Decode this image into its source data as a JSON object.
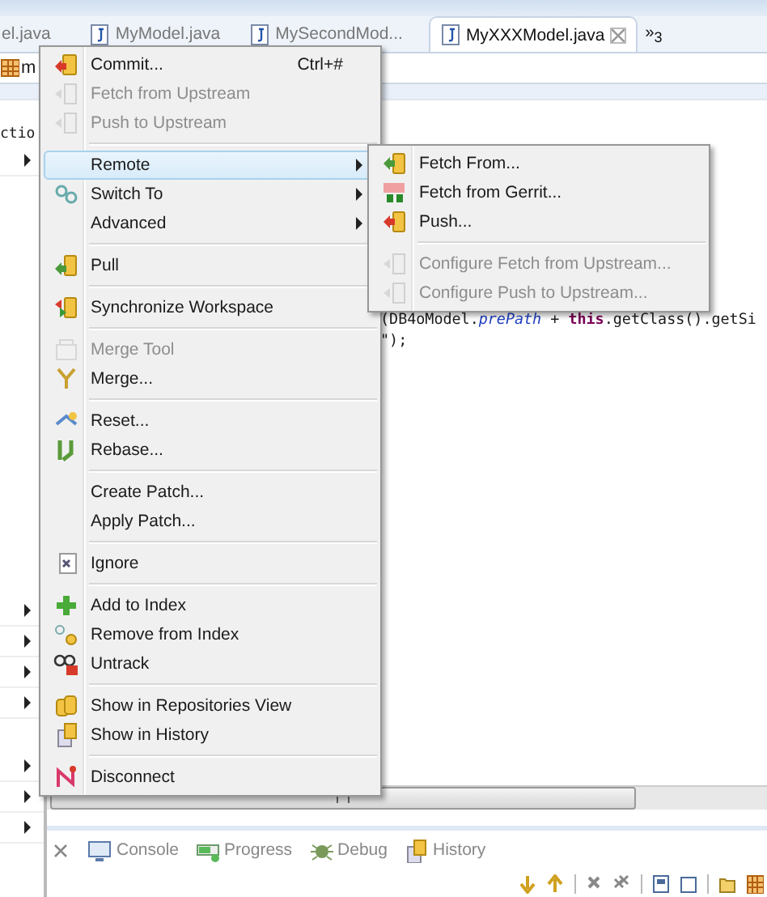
{
  "editor_tabs": [
    {
      "label": "el.java",
      "selected": false,
      "closable": false
    },
    {
      "label": "MyModel.java",
      "selected": false,
      "closable": false
    },
    {
      "label": "MySecondMod...",
      "selected": false,
      "closable": false
    },
    {
      "label": "MyXXXModel.java",
      "selected": true,
      "closable": true
    }
  ],
  "overflow_tabs": {
    "symbol": "»",
    "count": "3"
  },
  "breadcrumb": {
    "label": "m"
  },
  "outline": {
    "label": "ctio"
  },
  "editor": {
    "lines": [
      "(DB4oModel.*prePath* + **this**.getClass().getSi",
      "\");"
    ]
  },
  "context_menu": {
    "items": [
      {
        "kind": "item",
        "label": "Commit...",
        "shortcut": "Ctrl+#",
        "disabled": false,
        "submenu": false,
        "selected": false
      },
      {
        "kind": "item",
        "label": "Fetch from Upstream",
        "disabled": true,
        "submenu": false,
        "selected": false
      },
      {
        "kind": "item",
        "label": "Push to Upstream",
        "disabled": true,
        "submenu": false,
        "selected": false
      },
      {
        "kind": "separator"
      },
      {
        "kind": "item",
        "label": "Remote",
        "disabled": false,
        "submenu": true,
        "selected": true
      },
      {
        "kind": "item",
        "label": "Switch To",
        "disabled": false,
        "submenu": true,
        "selected": false
      },
      {
        "kind": "item",
        "label": "Advanced",
        "disabled": false,
        "submenu": true,
        "selected": false
      },
      {
        "kind": "separator"
      },
      {
        "kind": "item",
        "label": "Pull",
        "disabled": false,
        "submenu": false,
        "selected": false
      },
      {
        "kind": "separator"
      },
      {
        "kind": "item",
        "label": "Synchronize Workspace",
        "disabled": false,
        "submenu": false,
        "selected": false
      },
      {
        "kind": "separator"
      },
      {
        "kind": "item",
        "label": "Merge Tool",
        "disabled": true,
        "submenu": false,
        "selected": false
      },
      {
        "kind": "item",
        "label": "Merge...",
        "disabled": false,
        "submenu": false,
        "selected": false
      },
      {
        "kind": "separator"
      },
      {
        "kind": "item",
        "label": "Reset...",
        "disabled": false,
        "submenu": false,
        "selected": false
      },
      {
        "kind": "item",
        "label": "Rebase...",
        "disabled": false,
        "submenu": false,
        "selected": false
      },
      {
        "kind": "separator"
      },
      {
        "kind": "item",
        "label": "Create Patch...",
        "disabled": false,
        "submenu": false,
        "selected": false
      },
      {
        "kind": "item",
        "label": "Apply Patch...",
        "disabled": false,
        "submenu": false,
        "selected": false
      },
      {
        "kind": "separator"
      },
      {
        "kind": "item",
        "label": "Ignore",
        "disabled": false,
        "submenu": false,
        "selected": false
      },
      {
        "kind": "separator"
      },
      {
        "kind": "item",
        "label": "Add to Index",
        "disabled": false,
        "submenu": false,
        "selected": false
      },
      {
        "kind": "item",
        "label": "Remove from Index",
        "disabled": false,
        "submenu": false,
        "selected": false
      },
      {
        "kind": "item",
        "label": "Untrack",
        "disabled": false,
        "submenu": false,
        "selected": false
      },
      {
        "kind": "separator"
      },
      {
        "kind": "item",
        "label": "Show in Repositories View",
        "disabled": false,
        "submenu": false,
        "selected": false
      },
      {
        "kind": "item",
        "label": "Show in History",
        "disabled": false,
        "submenu": false,
        "selected": false
      },
      {
        "kind": "separator"
      },
      {
        "kind": "item",
        "label": "Disconnect",
        "disabled": false,
        "submenu": false,
        "selected": false
      }
    ]
  },
  "submenu": {
    "items": [
      {
        "kind": "item",
        "label": "Fetch From...",
        "disabled": false
      },
      {
        "kind": "item",
        "label": "Fetch from Gerrit...",
        "disabled": false
      },
      {
        "kind": "item",
        "label": "Push...",
        "disabled": false
      },
      {
        "kind": "separator"
      },
      {
        "kind": "item",
        "label": "Configure Fetch from Upstream...",
        "disabled": true
      },
      {
        "kind": "item",
        "label": "Configure Push to Upstream...",
        "disabled": true
      }
    ]
  },
  "bottom_tabs": [
    {
      "label": "Console"
    },
    {
      "label": "Progress"
    },
    {
      "label": "Debug"
    },
    {
      "label": "History"
    }
  ]
}
